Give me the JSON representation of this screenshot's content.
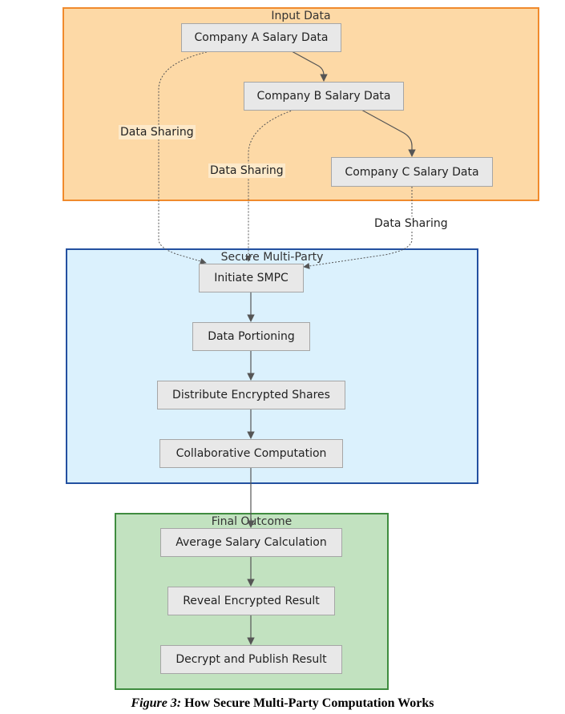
{
  "clusters": {
    "input": {
      "title": "Input Data",
      "fill": "#fdd9a6",
      "stroke": "#f08a2c"
    },
    "smpc": {
      "title": "Secure Multi-Party",
      "fill": "#dbf1fd",
      "stroke": "#2350a0"
    },
    "final": {
      "title": "Final Outcome",
      "fill": "#c2e2c0",
      "stroke": "#3f8c3f"
    }
  },
  "nodes": {
    "company_a": "Company A Salary Data",
    "company_b": "Company B Salary Data",
    "company_c": "Company C Salary Data",
    "initiate": "Initiate SMPC",
    "portioning": "Data Portioning",
    "distribute": "Distribute Encrypted Shares",
    "collaborative": "Collaborative Computation",
    "average": "Average Salary Calculation",
    "reveal": "Reveal Encrypted Result",
    "decrypt": "Decrypt and Publish Result"
  },
  "edges": [
    {
      "from": "company_a",
      "to": "company_b",
      "style": "solid",
      "label": ""
    },
    {
      "from": "company_b",
      "to": "company_c",
      "style": "solid",
      "label": ""
    },
    {
      "from": "company_a",
      "to": "initiate",
      "style": "dotted",
      "label": "Data Sharing"
    },
    {
      "from": "company_b",
      "to": "initiate",
      "style": "dotted",
      "label": "Data Sharing"
    },
    {
      "from": "company_c",
      "to": "initiate",
      "style": "dotted",
      "label": "Data Sharing"
    },
    {
      "from": "initiate",
      "to": "portioning",
      "style": "solid",
      "label": ""
    },
    {
      "from": "portioning",
      "to": "distribute",
      "style": "solid",
      "label": ""
    },
    {
      "from": "distribute",
      "to": "collaborative",
      "style": "solid",
      "label": ""
    },
    {
      "from": "collaborative",
      "to": "average",
      "style": "solid",
      "label": ""
    },
    {
      "from": "average",
      "to": "reveal",
      "style": "solid",
      "label": ""
    },
    {
      "from": "reveal",
      "to": "decrypt",
      "style": "solid",
      "label": ""
    }
  ],
  "edge_labels": {
    "a_sharing": "Data Sharing",
    "b_sharing": "Data Sharing",
    "c_sharing": "Data Sharing"
  },
  "caption": {
    "prefix": "Figure 3:",
    "text": " How Secure Multi-Party Computation Works"
  }
}
